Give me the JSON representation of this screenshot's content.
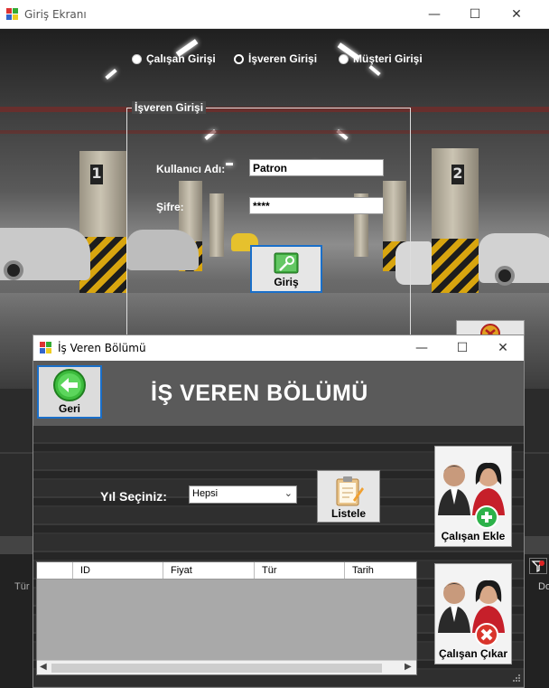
{
  "login_window": {
    "title": "Giriş Ekranı",
    "radio_options": [
      "Çalışan Girişi",
      "İşveren Girişi",
      "Müşteri Girişi"
    ],
    "selected_radio": "İşveren Girişi",
    "group_title": "İşveren Girişi",
    "username_label": "Kullanıcı Adı:",
    "username_value": "Patron",
    "password_label": "Şifre:",
    "password_value": "****",
    "login_button": "Giriş",
    "pillar_numbers": [
      "1",
      "2"
    ]
  },
  "employer_window": {
    "title": "İş Veren Bölümü",
    "heading": "İŞ VEREN BÖLÜMÜ",
    "back_button": "Geri",
    "year_label": "Yıl Seçiniz:",
    "year_value": "Hepsi",
    "list_button": "Listele",
    "add_employee_button": "Çalışan Ekle",
    "remove_employee_button": "Çalışan Çıkar",
    "grid_columns": [
      "ID",
      "Fiyat",
      "Tür",
      "Tarih"
    ]
  },
  "background_fragments": {
    "left_column_text": "Tür",
    "right_column_text": "Do"
  },
  "colors": {
    "accent_blue": "#1a6fc9",
    "window_bg": "#2d2d2d",
    "header_bg": "#5a5a5a"
  }
}
